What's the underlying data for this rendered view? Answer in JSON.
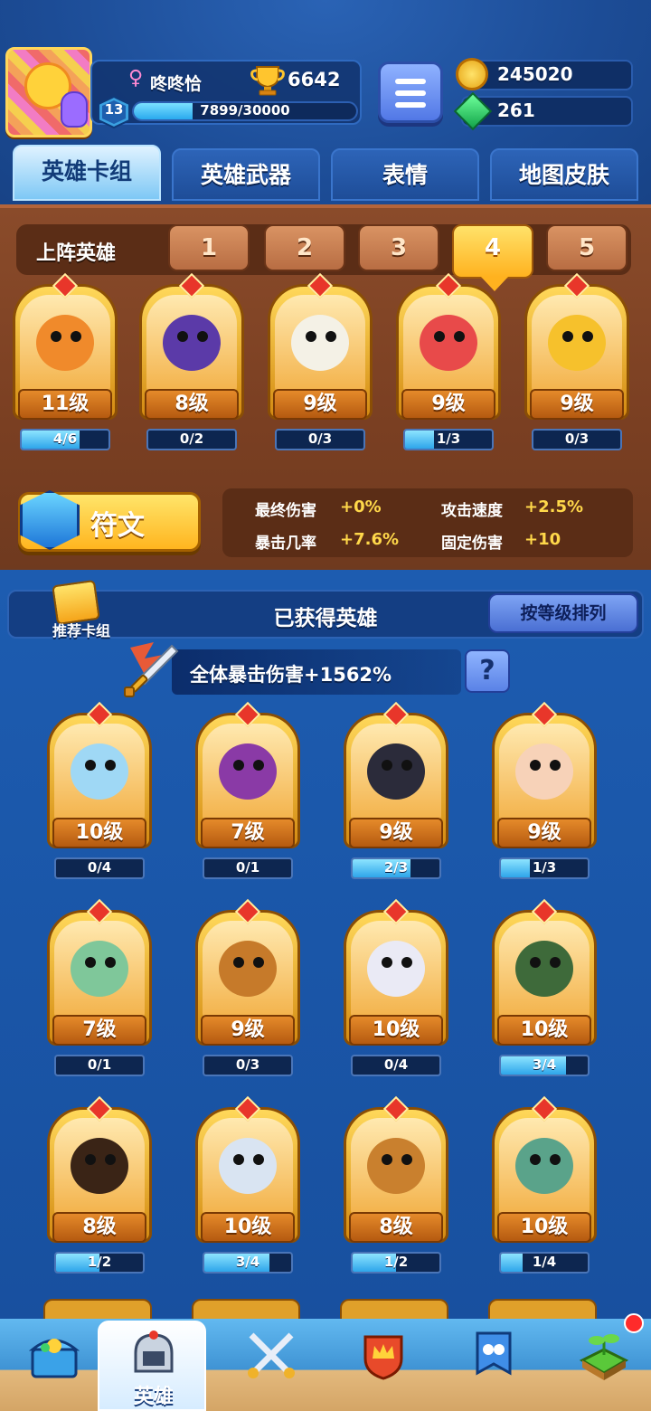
{
  "player": {
    "name": "咚咚恰",
    "gender_icon": "female-icon",
    "trophies": "6642",
    "level": "13",
    "xp_text": "7899/30000",
    "xp_fraction": 0.263
  },
  "resources": {
    "coins": "245020",
    "gems": "261"
  },
  "tabs": [
    "英雄卡组",
    "英雄武器",
    "表情",
    "地图皮肤"
  ],
  "active_tab": 0,
  "team": {
    "label": "上阵英雄",
    "slots": [
      "1",
      "2",
      "3",
      "4",
      "5"
    ],
    "active_slot": 3,
    "heroes": [
      {
        "level": "11级",
        "progress": "4/6",
        "fraction": 0.667,
        "color": "#f08a2b"
      },
      {
        "level": "8级",
        "progress": "0/2",
        "fraction": 0,
        "color": "#5b3aa8"
      },
      {
        "level": "9级",
        "progress": "0/3",
        "fraction": 0,
        "color": "#f4f1e6"
      },
      {
        "level": "9级",
        "progress": "1/3",
        "fraction": 0.333,
        "color": "#e84a4a"
      },
      {
        "level": "9级",
        "progress": "0/3",
        "fraction": 0,
        "color": "#f6c12c"
      }
    ]
  },
  "rune": {
    "label": "符文",
    "stats": [
      {
        "name": "最终伤害",
        "value": "+0%"
      },
      {
        "name": "攻击速度",
        "value": "+2.5%"
      },
      {
        "name": "暴击几率",
        "value": "+7.6%"
      },
      {
        "name": "固定伤害",
        "value": "+10"
      }
    ]
  },
  "owned": {
    "recommend_label": "推荐卡组",
    "title": "已获得英雄",
    "sort_label": "按等级排列",
    "crit_text": "全体暴击伤害+1562%",
    "help_label": "?",
    "heroes": [
      {
        "level": "10级",
        "progress": "0/4",
        "fraction": 0,
        "color": "#9fd8f5"
      },
      {
        "level": "7级",
        "progress": "0/1",
        "fraction": 0,
        "color": "#8a3aa6"
      },
      {
        "level": "9级",
        "progress": "2/3",
        "fraction": 0.667,
        "color": "#2b2b3a"
      },
      {
        "level": "9级",
        "progress": "1/3",
        "fraction": 0.333,
        "color": "#f7d2b8"
      },
      {
        "level": "7级",
        "progress": "0/1",
        "fraction": 0,
        "color": "#7fc79a"
      },
      {
        "level": "9级",
        "progress": "0/3",
        "fraction": 0,
        "color": "#c67a2a"
      },
      {
        "level": "10级",
        "progress": "0/4",
        "fraction": 0,
        "color": "#eaeaf5"
      },
      {
        "level": "10级",
        "progress": "3/4",
        "fraction": 0.75,
        "color": "#3e6a3a"
      },
      {
        "level": "8级",
        "progress": "1/2",
        "fraction": 0.5,
        "color": "#3a2416"
      },
      {
        "level": "10级",
        "progress": "3/4",
        "fraction": 0.75,
        "color": "#d9e4f2"
      },
      {
        "level": "8级",
        "progress": "1/2",
        "fraction": 0.5,
        "color": "#c9802e"
      },
      {
        "level": "10级",
        "progress": "1/4",
        "fraction": 0.25,
        "color": "#5aa38a"
      }
    ]
  },
  "nav": {
    "items": [
      "treasure-chest-icon",
      "helmet-icon",
      "crossed-swords-icon",
      "crown-shield-icon",
      "guild-banner-icon",
      "sprout-island-icon"
    ],
    "active_label": "英雄",
    "active_index": 1
  },
  "colors": {
    "accent_gold": "#ffb51f",
    "panel_brown": "#7a3f22",
    "bg_blue": "#1a56a8"
  }
}
